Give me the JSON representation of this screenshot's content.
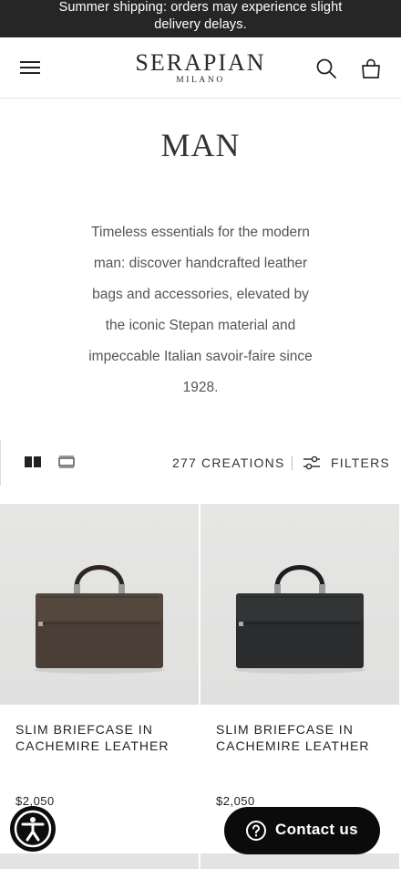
{
  "announcement": {
    "line1": "Summer shipping: orders may experience slight",
    "line2": "delivery delays."
  },
  "header": {
    "brand": "SERAPIAN",
    "city": "MILANO",
    "icons": [
      "menu-icon",
      "search-icon",
      "shopping-bag-icon"
    ]
  },
  "page": {
    "title": "MAN",
    "intro": "Timeless essentials for the modern man: discover handcrafted leather bags and accessories, elevated by the iconic Stepan material and impeccable Italian savoir-faire since 1928."
  },
  "toolbar": {
    "count": "277 CREATIONS",
    "filters_label": "FILTERS",
    "views": [
      "grid-two-icon",
      "grid-one-icon"
    ]
  },
  "products": [
    {
      "name": "SLIM BRIEFCASE IN CACHEMIRE LEATHER",
      "price": "$2,050",
      "color": "#4a3e36"
    },
    {
      "name": "SLIM BRIEFCASE IN CACHEMIRE LEATHER",
      "price": "$2,050",
      "color": "#2b2c2e"
    }
  ],
  "floating": {
    "contact_label": "Contact us",
    "accessibility_icon": "accessibility-icon"
  },
  "colors": {
    "announcement_bg": "#262626",
    "button_bg": "#0b0b0b"
  }
}
